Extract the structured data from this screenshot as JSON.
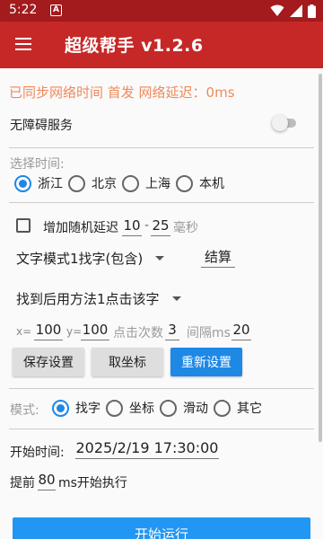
{
  "statusbar": {
    "time": "5:22",
    "notif_badge": "A"
  },
  "appbar": {
    "title": "超级帮手 v1.2.6"
  },
  "sync_status": "已同步网络时间 首发 网络延迟：0ms",
  "accessibility": {
    "label": "无障碍服务",
    "enabled": false
  },
  "time_select": {
    "label": "选择时间:",
    "options": [
      "浙江",
      "北京",
      "上海",
      "本机"
    ],
    "selected": "浙江"
  },
  "random_delay": {
    "label": "增加随机延迟",
    "checked": false,
    "min": "10",
    "separator": "-",
    "max": "25",
    "unit": "毫秒"
  },
  "text_mode": {
    "value": "文字模式1找字(包含)",
    "calc_label": "结算"
  },
  "click_method": {
    "value": "找到后用方法1点击该字"
  },
  "coords": {
    "x_label": "x=",
    "x_value": "100",
    "y_label": "y=",
    "y_value": "100",
    "count_label": "点击次数",
    "count_value": "3",
    "interval_label": "间隔ms",
    "interval_value": "20"
  },
  "buttons": {
    "save": "保存设置",
    "get_coords": "取坐标",
    "reset": "重新设置",
    "start": "开始运行"
  },
  "mode": {
    "label": "模式:",
    "options": [
      "找字",
      "坐标",
      "滑动",
      "其它"
    ],
    "selected": "找字"
  },
  "start_time": {
    "label": "开始时间:",
    "value": "2025/2/19 17:30:00"
  },
  "advance": {
    "prefix": "提前",
    "value": "80",
    "suffix": "ms开始执行"
  },
  "colors": {
    "appbar": "#c62828",
    "statusbar": "#a31b1d",
    "accent": "#1e88e5",
    "sync_text": "#ef8a5b"
  }
}
